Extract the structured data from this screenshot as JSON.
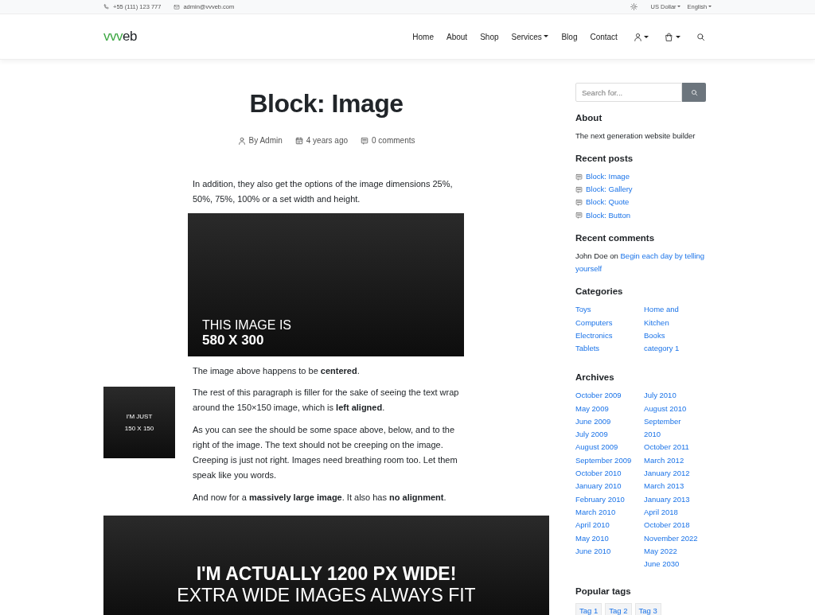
{
  "top_bar": {
    "phone": "+55 (111) 123 777",
    "email": "admin@vvveb.com",
    "currency": "US Dollar",
    "language": "English"
  },
  "logo": {
    "accent": "vvv",
    "rest": "eb"
  },
  "nav": [
    {
      "label": "Home",
      "dropdown": false
    },
    {
      "label": "About",
      "dropdown": false
    },
    {
      "label": "Shop",
      "dropdown": false
    },
    {
      "label": "Services",
      "dropdown": true
    },
    {
      "label": "Blog",
      "dropdown": false
    },
    {
      "label": "Contact",
      "dropdown": false
    }
  ],
  "nav_icons": [
    {
      "kind": "user",
      "dropdown": true
    },
    {
      "kind": "bag",
      "dropdown": true
    },
    {
      "kind": "search",
      "dropdown": false
    }
  ],
  "post": {
    "title": "Block: Image",
    "author": "By Admin",
    "date": "4 years ago",
    "comments": "0 comments",
    "intro": "In addition, they also get the options of the image dimensions 25%, 50%, 75%, 100% or a set width and height.",
    "image_medium": {
      "lines": [
        "THIS IMAGE IS",
        "580 X 300"
      ]
    },
    "caption": "The image above happens to be **centered**.",
    "image_small": {
      "lines": [
        "I'M JUST",
        "150 X 150"
      ]
    },
    "wrap_paragraphs": [
      "The rest of this paragraph is filler for the sake of seeing the text wrap around the 150×150 image, which is **left aligned**.",
      "As you can see the should be some space above, below, and to the right of the image. The text should not be creeping on the image. Creeping is just not right. Images need breathing room too. Let them speak like you words.",
      "And now for a **massively large image**. It also has **no alignment**."
    ],
    "image_large": {
      "lines": [
        "I'M ACTUALLY 1200 PX WIDE!",
        "EXTRA WIDE IMAGES ALWAYS FIT"
      ]
    }
  },
  "sidebar": {
    "search": {
      "placeholder": "Search for..."
    },
    "about": {
      "title": "About",
      "text": "The next generation website builder"
    },
    "recent_posts": {
      "title": "Recent posts",
      "items": [
        "Block: Image",
        "Block: Gallery",
        "Block: Quote",
        "Block: Button"
      ]
    },
    "recent_comments": {
      "title": "Recent comments",
      "author": "John Doe on",
      "link": "Begin each day by telling yourself"
    },
    "categories": {
      "title": "Categories",
      "columns": [
        [
          "Toys",
          "Computers",
          "Electronics",
          "Tablets"
        ],
        [
          "Home and Kitchen",
          "Books",
          "category 1"
        ]
      ]
    },
    "archives": {
      "title": "Archives",
      "columns": [
        [
          "October 2009",
          "May 2009",
          "June 2009",
          "July 2009",
          "August 2009",
          "September 2009",
          "October 2010",
          "January 2010",
          "February 2010",
          "March 2010",
          "April 2010",
          "May 2010",
          "June 2010"
        ],
        [
          "July 2010",
          "August 2010",
          "September 2010",
          "October 2011",
          "March 2012",
          "January 2012",
          "March 2013",
          "January 2013",
          "April 2018",
          "October 2018",
          "November 2022",
          "May 2022",
          "June 2030"
        ]
      ]
    },
    "tags": {
      "title": "Popular tags",
      "items": [
        "Tag 1",
        "Tag 2",
        "Tag 3"
      ]
    }
  }
}
